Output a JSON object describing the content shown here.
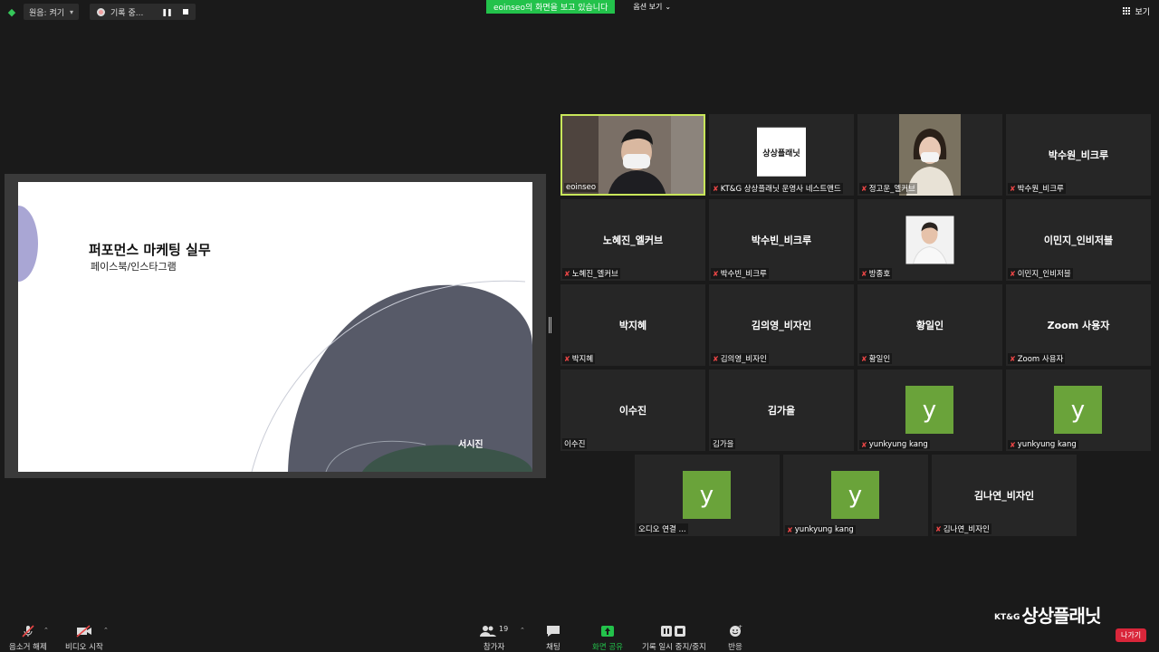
{
  "top_bar": {
    "audio_label": "원음: 켜기",
    "recording_label": "기록 중...",
    "share_banner": "eoinseo의 화면을 보고 있습니다",
    "view_options": "옵션 보기",
    "gallery_label": "보기"
  },
  "slide": {
    "title": "퍼포먼스 마케팅 실무",
    "subtitle": "페이스북/인스타그램",
    "author": "서시진"
  },
  "participants": [
    {
      "center": "",
      "label": "eoinseo",
      "muted": false,
      "kind": "video-person"
    },
    {
      "center": "",
      "label": "KT&G 상상플래닛 운영사 네스트앤드",
      "muted": true,
      "kind": "logo"
    },
    {
      "center": "",
      "label": "정고운_엘커브",
      "muted": true,
      "kind": "video-woman"
    },
    {
      "center": "박수원_비크루",
      "label": "박수원_비크루",
      "muted": true,
      "kind": "name"
    },
    {
      "center": "노혜진_엘커브",
      "label": "노혜진_엘커브",
      "muted": true,
      "kind": "name"
    },
    {
      "center": "박수빈_비크루",
      "label": "박수빈_비크루",
      "muted": true,
      "kind": "name"
    },
    {
      "center": "",
      "label": "방종호",
      "muted": true,
      "kind": "photo"
    },
    {
      "center": "이민지_인비저블",
      "label": "이민지_인비저블",
      "muted": true,
      "kind": "name"
    },
    {
      "center": "박지혜",
      "label": "박지혜",
      "muted": true,
      "kind": "name"
    },
    {
      "center": "김의영_비자인",
      "label": "김의영_비자인",
      "muted": true,
      "kind": "name"
    },
    {
      "center": "황일인",
      "label": "황일인",
      "muted": true,
      "kind": "name"
    },
    {
      "center": "Zoom 사용자",
      "label": "Zoom 사용자",
      "muted": true,
      "kind": "name"
    },
    {
      "center": "이수진",
      "label": "이수진",
      "muted": false,
      "kind": "name"
    },
    {
      "center": "김가을",
      "label": "김가을",
      "muted": false,
      "kind": "name"
    },
    {
      "center": "y",
      "label": "yunkyung kang",
      "muted": true,
      "kind": "avatar"
    },
    {
      "center": "y",
      "label": "yunkyung kang",
      "muted": true,
      "kind": "avatar"
    },
    {
      "center": "y",
      "label": "오디오 연결 ...",
      "muted": false,
      "kind": "avatar"
    },
    {
      "center": "y",
      "label": "yunkyung kang",
      "muted": true,
      "kind": "avatar"
    },
    {
      "center": "김나연_비자인",
      "label": "김나연_비자인",
      "muted": true,
      "kind": "name"
    }
  ],
  "logo_text": "상상플래닛",
  "toolbar": {
    "unmute": "음소거 해제",
    "start_video": "비디오 시작",
    "participants": "참가자",
    "participants_count": "19",
    "chat": "채팅",
    "share_screen": "화면 공유",
    "pause_recording": "기록 일시 중지/중지",
    "reactions": "반응",
    "leave": "나가기"
  },
  "brand": {
    "prefix": "KT&G",
    "name": "상상플래닛"
  },
  "colors": {
    "share_green": "#23c24b",
    "active_speaker": "#c8e65a",
    "avatar_green": "#6aa33a",
    "leave_red": "#d9263a",
    "muted_red": "#e84545"
  }
}
